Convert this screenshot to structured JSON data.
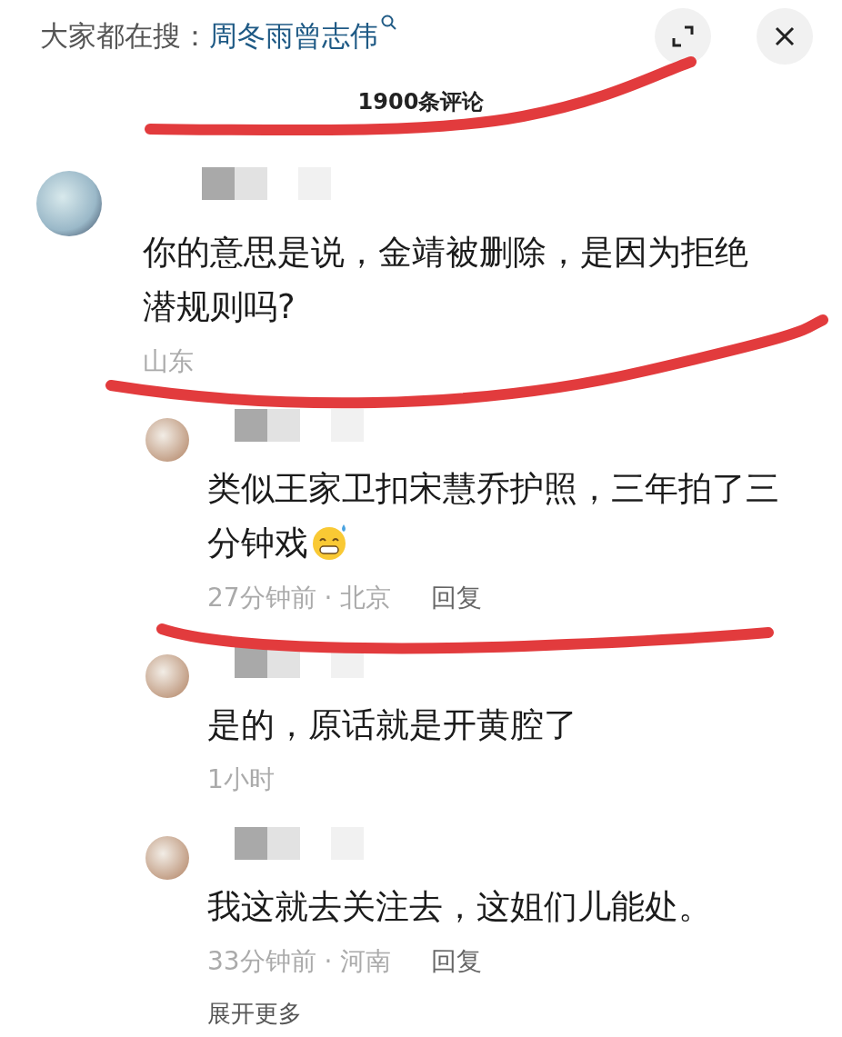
{
  "header": {
    "label": "大家都在搜：",
    "query": "周冬雨曾志伟"
  },
  "comment_count": "1900条评论",
  "comments": [
    {
      "kind": "top",
      "text": "你的意思是说，金靖被删除，是因为拒绝潜规则吗?",
      "has_emoji": false,
      "meta": "山东"
    },
    {
      "kind": "reply",
      "text": "类似王家卫扣宋慧乔护照，三年拍了三分钟戏",
      "has_emoji": true,
      "meta": "27分钟前 · 北京",
      "reply": "回复"
    },
    {
      "kind": "reply",
      "text": "是的，原话就是开黄腔了",
      "has_emoji": false,
      "meta": "1小时"
    },
    {
      "kind": "reply",
      "text": "我这就去关注去，这姐们儿能处。",
      "has_emoji": false,
      "meta": "33分钟前 · 河南",
      "reply": "回复"
    }
  ],
  "more": "展开更多"
}
